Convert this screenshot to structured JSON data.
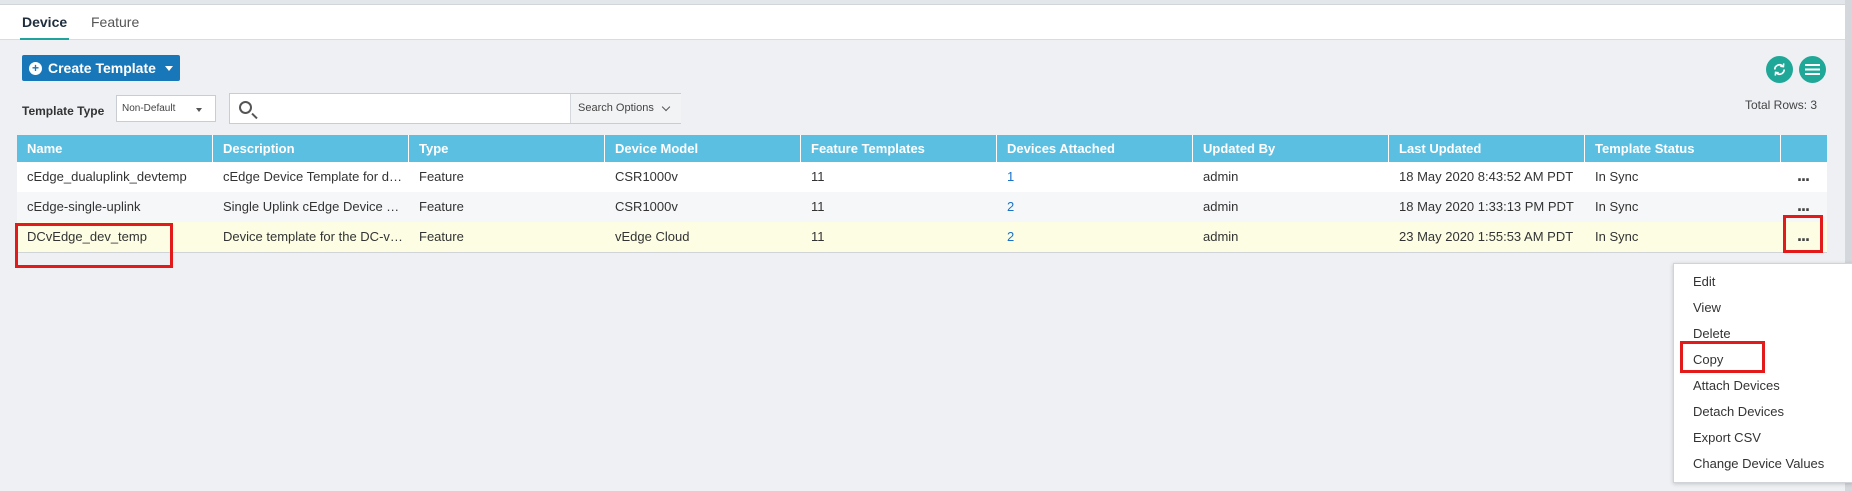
{
  "tabs": [
    {
      "label": "Device",
      "active": true
    },
    {
      "label": "Feature",
      "active": false
    }
  ],
  "toolbar": {
    "create_label": "Create Template",
    "template_type_label": "Template Type",
    "template_type_value": "Non-Default",
    "search_value": "",
    "search_options_label": "Search Options",
    "total_rows": "Total Rows: 3"
  },
  "table": {
    "columns": [
      "Name",
      "Description",
      "Type",
      "Device Model",
      "Feature Templates",
      "Devices Attached",
      "Updated By",
      "Last Updated",
      "Template Status"
    ],
    "rows": [
      {
        "name": "cEdge_dualuplink_devtemp",
        "description": "cEdge Device Template for de...",
        "type": "Feature",
        "device_model": "CSR1000v",
        "feature_templates": "11",
        "devices_attached": "1",
        "updated_by": "admin",
        "last_updated": "18 May 2020 8:43:52 AM PDT",
        "status": "In Sync",
        "actions": "..."
      },
      {
        "name": "cEdge-single-uplink",
        "description": "Single Uplink cEdge Device Te...",
        "type": "Feature",
        "device_model": "CSR1000v",
        "feature_templates": "11",
        "devices_attached": "2",
        "updated_by": "admin",
        "last_updated": "18 May 2020 1:33:13 PM PDT",
        "status": "In Sync",
        "actions": "..."
      },
      {
        "name": "DCvEdge_dev_temp",
        "description": "Device template for the DC-vE...",
        "type": "Feature",
        "device_model": "vEdge Cloud",
        "feature_templates": "11",
        "devices_attached": "2",
        "updated_by": "admin",
        "last_updated": "23 May 2020 1:55:53 AM PDT",
        "status": "In Sync",
        "actions": "..."
      }
    ]
  },
  "context_menu": [
    "Edit",
    "View",
    "Delete",
    "Copy",
    "Attach Devices",
    "Detach Devices",
    "Export CSV",
    "Change Device Values"
  ],
  "colors": {
    "table_header": "#5bbfe2",
    "primary_button": "#1877b8",
    "accent_teal": "#1fa898",
    "highlight_box": "#e21a1a",
    "selected_row": "#fdfde4"
  },
  "icons": {
    "create": "plus-circle-icon",
    "refresh": "refresh-icon",
    "menu": "hamburger-menu-icon",
    "search": "search-icon"
  }
}
